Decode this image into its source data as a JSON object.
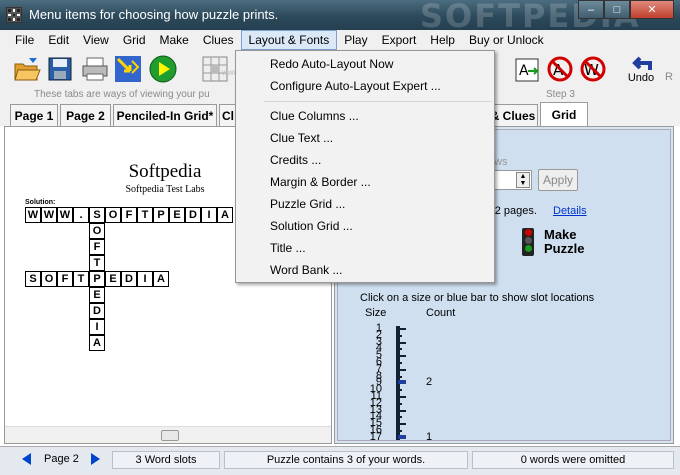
{
  "window": {
    "title": "Menu items for choosing how puzzle prints.",
    "watermark": "SOFTPEDIA",
    "min": "–",
    "max": "□",
    "close": "✕"
  },
  "menubar": [
    "File",
    "Edit",
    "View",
    "Grid",
    "Make",
    "Clues",
    "Layout & Fonts",
    "Play",
    "Export",
    "Help",
    "Buy or Unlock"
  ],
  "toolbar": {
    "undo_label": "Undo",
    "r_label": "R",
    "watermark": "www.softpedia.com",
    "tools": [
      {
        "icon": "open-folder-icon"
      },
      {
        "icon": "save-icon"
      },
      {
        "icon": "print-icon"
      },
      {
        "icon": "auto-layout-icon"
      },
      {
        "icon": "play-icon"
      },
      {
        "icon": "grid-pattern-icon"
      },
      {
        "icon": "word-arrow-icon"
      },
      {
        "icon": "no-a-icon"
      },
      {
        "icon": "no-w-icon"
      },
      {
        "icon": "undo-icon"
      }
    ]
  },
  "steps": {
    "hint": "These tabs are ways of viewing your pu",
    "step3": "Step 3"
  },
  "tabs": [
    {
      "label": "Page 1"
    },
    {
      "label": "Page 2"
    },
    {
      "label": "Penciled-In Grid*"
    },
    {
      "label": "Cl"
    },
    {
      "label": "& Clues"
    },
    {
      "label": "Grid"
    }
  ],
  "layout_menu": {
    "items": [
      "Redo Auto-Layout Now",
      "Configure Auto-Layout Expert ...",
      "Clue Columns ...",
      "Clue Text ...",
      "Credits ...",
      "Margin & Border ...",
      "Puzzle Grid ...",
      "Solution Grid ...",
      "Title ...",
      "Word Bank ..."
    ]
  },
  "puzzle": {
    "title": "Softpedia",
    "subtitle": "Softpedia Test Labs",
    "solution_label": "Solution:",
    "row1": [
      "W",
      "W",
      "W",
      ".",
      "S",
      "O",
      "F",
      "T",
      "P",
      "E",
      "D",
      "I",
      "A"
    ],
    "row2": [
      "S",
      "O",
      "F",
      "T",
      "P",
      "E",
      "D",
      "I",
      "A"
    ],
    "column": [
      "S",
      "O",
      "F",
      "T",
      "P",
      "E",
      "D",
      "I",
      "A"
    ]
  },
  "settings": {
    "rows_label": "ows",
    "apply_label": "Apply",
    "pages_text": "r 2 pages.",
    "details_label": "Details",
    "make_puzzle_label": "Make Puzzle",
    "slot_hint": "Click on a size or blue bar to show slot locations",
    "size_label": "Size",
    "count_label": "Count",
    "sizes": [
      "1",
      "2",
      "3",
      "4",
      "5",
      "6",
      "7",
      "8",
      "9",
      "10",
      "11",
      "12",
      "13",
      "14",
      "15",
      "16",
      "17"
    ],
    "counts": [
      {
        "size": 9,
        "count": "2"
      },
      {
        "size": 17,
        "count": "1"
      }
    ]
  },
  "statusbar": {
    "page": "Page 2",
    "slots": "3 Word slots",
    "contains": "Puzzle contains 3 of your words.",
    "omitted": "0 words were omitted"
  },
  "colors": {
    "title_bar": "#2d4a5c",
    "link": "#0033cc",
    "status_nav": "#0044cc",
    "pane": "#d6e4f2"
  }
}
